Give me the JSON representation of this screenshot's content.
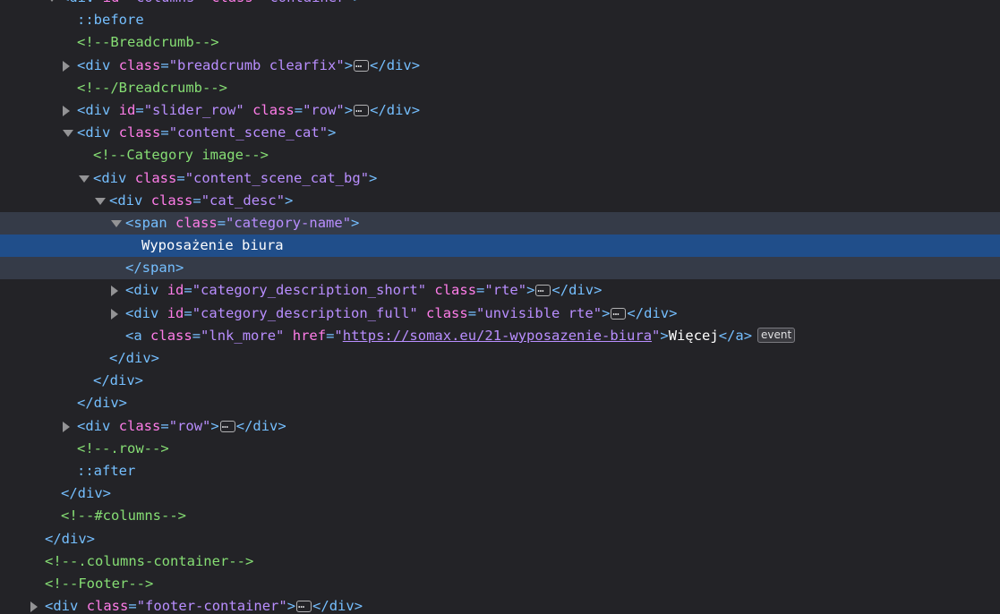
{
  "nodes": [
    {
      "indent": 4,
      "twisty": "expanded",
      "type": "tag-open",
      "tag": "div",
      "attrs": [
        {
          "name": "id",
          "value": "columns"
        },
        {
          "name": "class",
          "value": "container"
        }
      ],
      "clip": true
    },
    {
      "indent": 5,
      "type": "pseudo",
      "text": "::before"
    },
    {
      "indent": 5,
      "type": "comment",
      "text": "<!--Breadcrumb-->"
    },
    {
      "indent": 5,
      "twisty": "collapsed",
      "type": "tag-collapsed",
      "tag": "div",
      "attrs": [
        {
          "name": "class",
          "value": "breadcrumb clearfix"
        }
      ]
    },
    {
      "indent": 5,
      "type": "comment",
      "text": "<!--/Breadcrumb-->"
    },
    {
      "indent": 5,
      "twisty": "collapsed",
      "type": "tag-collapsed",
      "tag": "div",
      "attrs": [
        {
          "name": "id",
          "value": "slider_row"
        },
        {
          "name": "class",
          "value": "row"
        }
      ]
    },
    {
      "indent": 5,
      "twisty": "expanded",
      "type": "tag-open",
      "tag": "div",
      "attrs": [
        {
          "name": "class",
          "value": "content_scene_cat"
        }
      ]
    },
    {
      "indent": 6,
      "type": "comment",
      "text": "<!--Category image-->"
    },
    {
      "indent": 6,
      "twisty": "expanded",
      "type": "tag-open",
      "tag": "div",
      "attrs": [
        {
          "name": "class",
          "value": "content_scene_cat_bg"
        }
      ]
    },
    {
      "indent": 7,
      "twisty": "expanded",
      "type": "tag-open",
      "tag": "div",
      "attrs": [
        {
          "name": "class",
          "value": "cat_desc"
        }
      ]
    },
    {
      "indent": 8,
      "twisty": "expanded",
      "type": "tag-open",
      "tag": "span",
      "attrs": [
        {
          "name": "class",
          "value": "category-name"
        }
      ],
      "focus": true
    },
    {
      "indent": 9,
      "type": "text",
      "text": "Wyposażenie biura",
      "selected": true
    },
    {
      "indent": 8,
      "type": "tag-close",
      "tag": "span",
      "focus": true
    },
    {
      "indent": 8,
      "twisty": "collapsed",
      "type": "tag-collapsed",
      "tag": "div",
      "attrs": [
        {
          "name": "id",
          "value": "category_description_short"
        },
        {
          "name": "class",
          "value": "rte"
        }
      ]
    },
    {
      "indent": 8,
      "twisty": "collapsed",
      "type": "tag-collapsed",
      "tag": "div",
      "attrs": [
        {
          "name": "id",
          "value": "category_description_full"
        },
        {
          "name": "class",
          "value": "unvisible rte"
        }
      ]
    },
    {
      "indent": 8,
      "type": "tag-inline",
      "tag": "a",
      "attrs": [
        {
          "name": "class",
          "value": "lnk_more"
        },
        {
          "name": "href",
          "value": "https://somax.eu/21-wyposazenie-biura",
          "link": true
        }
      ],
      "inner": "Więcej",
      "badge": "event"
    },
    {
      "indent": 7,
      "type": "tag-close",
      "tag": "div"
    },
    {
      "indent": 6,
      "type": "tag-close",
      "tag": "div"
    },
    {
      "indent": 5,
      "type": "tag-close",
      "tag": "div"
    },
    {
      "indent": 5,
      "twisty": "collapsed",
      "type": "tag-collapsed",
      "tag": "div",
      "attrs": [
        {
          "name": "class",
          "value": "row"
        }
      ]
    },
    {
      "indent": 5,
      "type": "comment",
      "text": "<!--.row-->"
    },
    {
      "indent": 5,
      "type": "pseudo",
      "text": "::after"
    },
    {
      "indent": 4,
      "type": "tag-close",
      "tag": "div"
    },
    {
      "indent": 4,
      "type": "comment",
      "text": "<!--#columns-->"
    },
    {
      "indent": 3,
      "type": "tag-close",
      "tag": "div"
    },
    {
      "indent": 3,
      "type": "comment",
      "text": "<!--.columns-container-->"
    },
    {
      "indent": 3,
      "type": "comment",
      "text": "<!--Footer-->"
    },
    {
      "indent": 3,
      "twisty": "collapsed",
      "type": "tag-collapsed",
      "tag": "div",
      "attrs": [
        {
          "name": "class",
          "value": "footer-container"
        }
      ]
    }
  ],
  "colors": {
    "background": "#232327",
    "selected": "#204e8a",
    "focus_group": "#353b48",
    "tag": "#75bfff",
    "attr_name": "#ff7de9",
    "attr_value": "#b98eff",
    "comment": "#86de74"
  },
  "icons": {
    "collapsed": "triangle-right-icon",
    "expanded": "triangle-down-icon",
    "ellipsis": "ellipsis-icon"
  }
}
